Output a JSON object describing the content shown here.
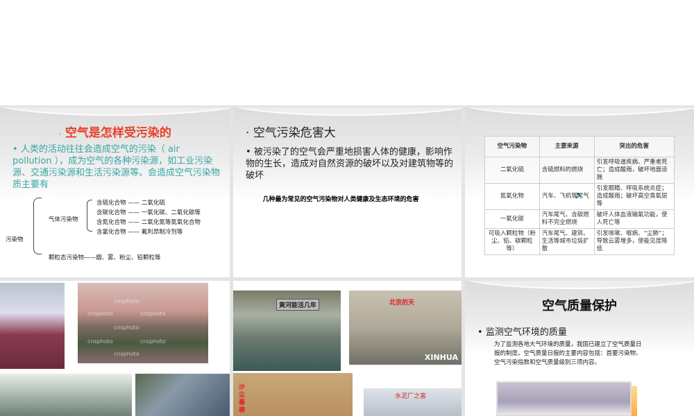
{
  "slides": [
    {
      "title": "空气是怎样受污染的",
      "body": "人类的活动往往会造成空气的污染（ air pollution ），成为空气的各种污染源，如工业污染源、交通污染源和生活污染源等。会造成空气污染物质主要有",
      "tree": {
        "root": "污染物",
        "gas": "气体污染物",
        "gas_items": [
          "含硫化合物 —— 二氧化硫",
          "含碳化合物 —— 一氧化碳、二氧化碳等",
          "含氮化合物 —— 二氧化氮等氮氧化合物",
          "含氯化合物 —— 氟利昂制冷剂等"
        ],
        "particle": "颗粒态污染物——烟、雾、粉尘、铅颗粒等"
      }
    },
    {
      "title": "空气污染危害大",
      "body": "被污染了的空气会严重地损害人体的健康，影响作物的生长，造成对自然资源的破坏以及对建筑物等的破坏",
      "caption": "几种最为常见的空气污染物对人类健康及生态环境的危害"
    },
    {
      "table": {
        "headers": [
          "空气污染物",
          "主要来源",
          "突出的危害"
        ],
        "rows": [
          [
            "二氧化硫",
            "含硫燃料的燃烧",
            "引发呼吸道疾病、严重者死亡；造成酸雨，破坏地面设施"
          ],
          [
            "氮氧化物",
            "汽车、飞机等尾气",
            "引发眼睛、呼吸系统炎症；造成酸雨；破坏高空臭氧层等"
          ],
          [
            "一氧化碳",
            "汽车尾气、含碳燃料不完全燃烧",
            "破坏人体血液输氧功能，使人死亡等"
          ],
          [
            "可吸入颗粒物（粉尘、铅、碳颗粒等）",
            "汽车尾气、建筑、生活等城市垃圾扩散",
            "引发咳嗽、喉病、“尘肺”；导致云雾增多，使能见度降低"
          ]
        ]
      }
    },
    {
      "watermark": "cnsphoto"
    },
    {
      "labels": [
        "黄河能活几年",
        "北京的天",
        "XINHUA",
        "沙尘暴袭",
        "水泥厂之害"
      ]
    },
    {
      "title": "空气质量保护",
      "bullet": "监测空气环境的质量",
      "body": "为了监测各地大气环境的质量，我国已建立了空气质量日报的制度。空气质量日报的主要内容包括：首要污染物、空气污染指数和空气质量级别三项内容。"
    }
  ]
}
